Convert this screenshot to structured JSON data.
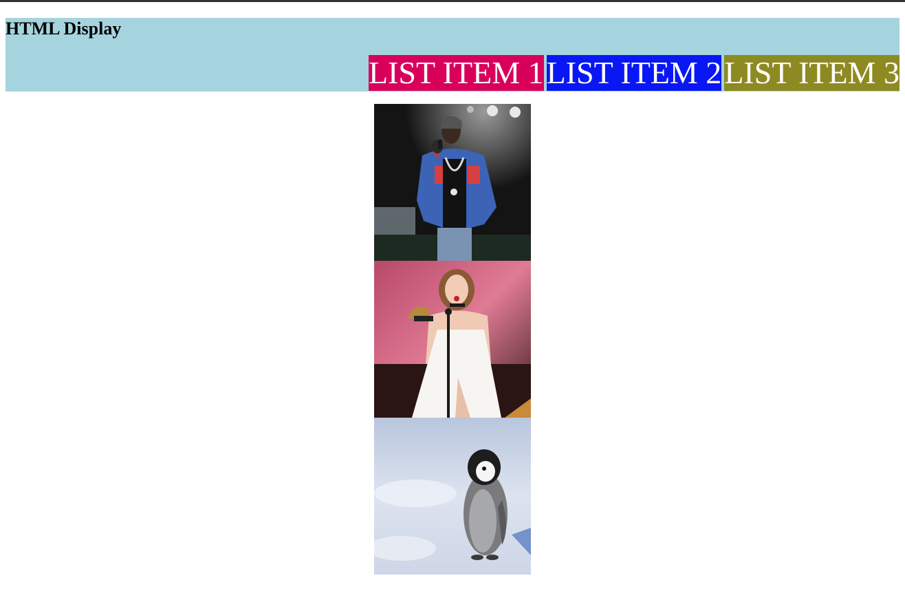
{
  "header": {
    "title": "HTML Display",
    "background": "#a6d4de"
  },
  "nav": {
    "items": [
      {
        "label": "LIST ITEM 1",
        "color": "#d9005c"
      },
      {
        "label": "LIST ITEM 2",
        "color": "#0a17f5"
      },
      {
        "label": "LIST ITEM 3",
        "color": "#8e8a22"
      }
    ]
  },
  "gallery": {
    "images": [
      {
        "subject": "rapper-performing-photo"
      },
      {
        "subject": "singer-award-photo"
      },
      {
        "subject": "penguin-chick-photo"
      }
    ]
  }
}
